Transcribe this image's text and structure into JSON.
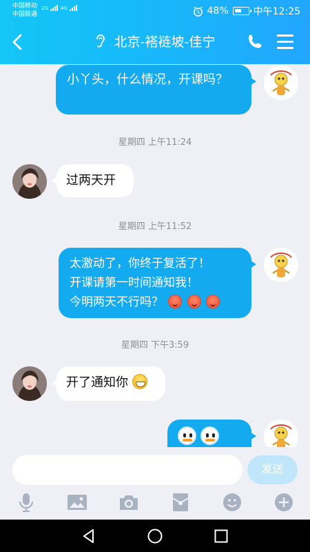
{
  "status": {
    "carrier1": "中国移动",
    "carrier2": "中国联通",
    "net1": "2G",
    "net2": "4G",
    "battery": "48%",
    "time": "中午12:25"
  },
  "header": {
    "title": "北京-褡裢坡-佳宁"
  },
  "messages": [
    {
      "id": "m1",
      "dir": "out",
      "text": "小丫头，什么情况，开课吗？"
    },
    {
      "id": "t1",
      "type": "timestamp",
      "text": "星期四 上午11:24"
    },
    {
      "id": "m2",
      "dir": "in",
      "text": "过两天开"
    },
    {
      "id": "t2",
      "type": "timestamp",
      "text": "星期四 上午11:52"
    },
    {
      "id": "m3",
      "dir": "out",
      "line1": "太激动了，你终于复活了！",
      "line2": "开课请第一时间通知我！",
      "line3": "今明两天不行吗？"
    },
    {
      "id": "t3",
      "type": "timestamp",
      "text": "星期四 下午3:59"
    },
    {
      "id": "m4",
      "dir": "in",
      "text": "开了通知你"
    },
    {
      "id": "m5",
      "dir": "out",
      "emoji_count": 3
    }
  ],
  "input": {
    "placeholder": "",
    "value": "",
    "send_label": "发送"
  },
  "colors": {
    "header": "#18b6fb",
    "bubble_out": "#13aaf0",
    "bubble_in": "#ffffff",
    "background": "#eef0f5"
  },
  "icons": {
    "toolbar": [
      "microphone-icon",
      "image-icon",
      "camera-icon",
      "red-packet-icon",
      "emoji-icon",
      "plus-icon"
    ],
    "nav": [
      "back-triangle-icon",
      "home-circle-icon",
      "recents-square-icon"
    ]
  }
}
